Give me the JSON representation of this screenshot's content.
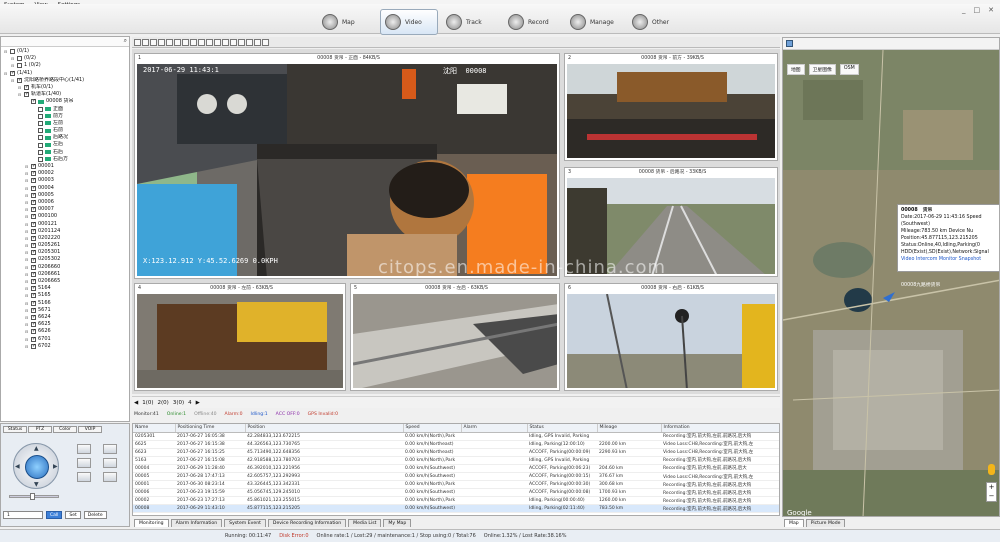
{
  "menu": {
    "items": [
      "System",
      "View",
      "Settings"
    ]
  },
  "nav": {
    "tabs": [
      {
        "id": "map",
        "label": "Map",
        "icon": "map-icon"
      },
      {
        "id": "video",
        "label": "Video",
        "icon": "video-icon",
        "active": true
      },
      {
        "id": "track",
        "label": "Track",
        "icon": "track-icon"
      },
      {
        "id": "record",
        "label": "Record",
        "icon": "record-icon"
      },
      {
        "id": "manage",
        "label": "Manage",
        "icon": "manage-icon"
      },
      {
        "id": "other",
        "label": "Other",
        "icon": "other-icon"
      }
    ]
  },
  "window_controls": [
    "_",
    "□",
    "✕"
  ],
  "tree": {
    "rows": [
      {
        "i": 0,
        "t": "(0/1)",
        "cb": false
      },
      {
        "i": 1,
        "t": "(0/2)",
        "cb": false
      },
      {
        "i": 1,
        "t": "1  (0/2)",
        "cb": false
      },
      {
        "i": 0,
        "t": "(1/41)",
        "cb": true
      },
      {
        "i": 1,
        "t": "沈阳路桥养路段中心(1/41)",
        "cb": true
      },
      {
        "i": 2,
        "t": "机车(0/1)",
        "cb": true
      },
      {
        "i": 2,
        "t": "轨道车(1/40)",
        "cb": true
      },
      {
        "i": 3,
        "t": "00008  货吊",
        "cb": true,
        "v": true
      },
      {
        "i": 4,
        "t": "正面",
        "cb": false,
        "v": true
      },
      {
        "i": 4,
        "t": "前方",
        "cb": false,
        "v": true
      },
      {
        "i": 4,
        "t": "左前",
        "cb": false,
        "v": true
      },
      {
        "i": 4,
        "t": "右前",
        "cb": false,
        "v": true
      },
      {
        "i": 4,
        "t": "后路况",
        "cb": false,
        "v": true
      },
      {
        "i": 4,
        "t": "左后",
        "cb": false,
        "v": true
      },
      {
        "i": 4,
        "t": "右后",
        "cb": false,
        "v": true
      },
      {
        "i": 4,
        "t": "右后方",
        "cb": false,
        "v": true
      },
      {
        "i": 3,
        "t": "00001",
        "cb": true
      },
      {
        "i": 3,
        "t": "00002",
        "cb": true
      },
      {
        "i": 3,
        "t": "00003",
        "cb": true
      },
      {
        "i": 3,
        "t": "00004",
        "cb": true
      },
      {
        "i": 3,
        "t": "00005",
        "cb": true
      },
      {
        "i": 3,
        "t": "00006",
        "cb": true
      },
      {
        "i": 3,
        "t": "00007",
        "cb": true
      },
      {
        "i": 3,
        "t": "000100",
        "cb": true
      },
      {
        "i": 3,
        "t": "000121",
        "cb": true
      },
      {
        "i": 3,
        "t": "0201124",
        "cb": true
      },
      {
        "i": 3,
        "t": "0202220",
        "cb": true
      },
      {
        "i": 3,
        "t": "0205261",
        "cb": true
      },
      {
        "i": 3,
        "t": "0205301",
        "cb": true
      },
      {
        "i": 3,
        "t": "0205302",
        "cb": true
      },
      {
        "i": 3,
        "t": "0206660",
        "cb": true
      },
      {
        "i": 3,
        "t": "0206661",
        "cb": true
      },
      {
        "i": 3,
        "t": "0206665",
        "cb": true
      },
      {
        "i": 3,
        "t": "5164",
        "cb": true
      },
      {
        "i": 3,
        "t": "5165",
        "cb": true
      },
      {
        "i": 3,
        "t": "5166",
        "cb": true
      },
      {
        "i": 3,
        "t": "5671",
        "cb": true
      },
      {
        "i": 3,
        "t": "6624",
        "cb": true
      },
      {
        "i": 3,
        "t": "6625",
        "cb": true
      },
      {
        "i": 3,
        "t": "6626",
        "cb": true
      },
      {
        "i": 3,
        "t": "6701",
        "cb": true
      },
      {
        "i": 3,
        "t": "6702",
        "cb": true
      }
    ]
  },
  "ptz": {
    "tabs": [
      "Status",
      "PTZ",
      "Color",
      "VOIP"
    ],
    "preset": "1",
    "buttons": [
      "Call",
      "Set",
      "Delete"
    ]
  },
  "videos": [
    {
      "num": "1",
      "veh": "00008",
      "ch": "货吊 - 正面",
      "speed": "84KB/S",
      "time": "2017-06-29 11:43:1",
      "coord": "X:123.12.912 Y:45.52.6269 0.0KPH",
      "plate": "沈阳",
      "code": "00008"
    },
    {
      "num": "2",
      "veh": "00008",
      "ch": "货吊 - 前方",
      "speed": "39KB/S"
    },
    {
      "num": "3",
      "veh": "00008",
      "ch": "货吊 - 后路况",
      "speed": "33KB/S"
    },
    {
      "num": "4",
      "veh": "00008",
      "ch": "货吊 - 左前",
      "speed": "63KB/S"
    },
    {
      "num": "5",
      "veh": "00008",
      "ch": "货吊 - 左后",
      "speed": "63KB/S"
    },
    {
      "num": "6",
      "veh": "00008",
      "ch": "货吊 - 右后",
      "speed": "61KB/S"
    }
  ],
  "watermark": "citops.en.made-in-china.com",
  "pager": {
    "items": [
      "1(0)",
      "2(0)",
      "3(0)",
      "4"
    ]
  },
  "stats": [
    "Monitor:41",
    "Online:1",
    "Offline:40",
    "Alarm:0",
    "Idling:1",
    "ACC OFF:0",
    "GPS Invalid:0"
  ],
  "gps": {
    "headers": [
      "Name",
      "Positioning Time",
      "Position",
      "Speed",
      "Alarm",
      "Status",
      "Mileage",
      "Information"
    ],
    "rows": [
      [
        "0205301",
        "2017-06-27 16:05:38",
        "42.284833,123.672215",
        "0.00 km/h(North),Park",
        "",
        "Idling, GPS Invalid, Parking",
        "",
        "Recording:室内,前大钩,左前,前路况,后大钩"
      ],
      [
        "6625",
        "2017-06-27 16:15:38",
        "44.326563,123.730765",
        "0.00 km/h(Northeast)",
        "",
        "Idling, Parking(12:00:10)",
        "2200.00 km",
        "Video Loss:CH8,Recording:室内,前大钩,左"
      ],
      [
        "6623",
        "2017-06-27 16:15:25",
        "45.713490,122.648356",
        "0.00 km/h(Northeast)",
        "",
        "ACCOFF, Parking(00:00:09)",
        "2290.93 km",
        "Video Loss:CH8,Recording:室内,前大钩,左"
      ],
      [
        "5163",
        "2017-06-27 16:15:08",
        "42.918588,123.780703",
        "0.00 km/h(North),Park",
        "",
        "Idling, GPS Invalid, Parking",
        "",
        "Recording:室内,前大钩,左前,前路况,后大钩"
      ],
      [
        "00004",
        "2017-06-29 11:28:40",
        "46.392010,123.221956",
        "0.00 km/h(Southwest)",
        "",
        "ACCOFF, Parking(00:06:23)",
        "204.60 km",
        "Recording:室内,前大钩,左前,前路况,后大"
      ],
      [
        "00005",
        "2017-06-28 17:47:13",
        "42.605757,123.292993",
        "0.00 km/h(Southwest)",
        "",
        "ACCOFF, Parking(00:00:15)",
        "376.67 km",
        "Video Loss:CH8,Recording:室内,前大钩,左"
      ],
      [
        "00001",
        "2017-06-30 08:23:14",
        "43.326445,123.342331",
        "0.00 km/h(North),Park",
        "",
        "ACCOFF, Parking(00:00:30)",
        "300.68 km",
        "Recording:室内,前大钩,左前,前路况,后大钩"
      ],
      [
        "00006",
        "2017-06-23 19:15:59",
        "45.056745,129.245010",
        "0.00 km/h(Southwest)",
        "",
        "ACCOFF, Parking(00:00:08)",
        "1700.93 km",
        "Recording:室内,前大钩,左前,前路况,后大钩"
      ],
      [
        "00002",
        "2017-06-23 17:27:13",
        "45.861021,123.255015",
        "0.00 km/h(North),Park",
        "",
        "Idling, Parking(00:00:40)",
        "1260.00 km",
        "Recording:室内,前大钩,左前,前路况,后大钩"
      ],
      [
        "00008",
        "2017-06-29 11:43:10",
        "45.877115,123.215205",
        "0.00 km/h(Southwest)",
        "",
        "Idling, Parking(02:11:40)",
        "783.50 km",
        "Recording:室内,前大钩,左前,前路况,后大钩"
      ]
    ]
  },
  "bottom_tabs": [
    "Monitoring",
    "Alarm Information",
    "System Event",
    "Device Recording Information",
    "Media List",
    "My Map"
  ],
  "map": {
    "types": [
      "地图",
      "卫星图像",
      "OSM"
    ],
    "info": {
      "title": "00008",
      "title_cn": "货吊",
      "lines": [
        "Date:2017-06-29 11:43:16  Speed",
        "(Southwest)",
        "Mileage:783.50 km  Device Nu",
        "Position:45.877115,123.215205",
        "Status:Online,40,Idling,Parking(0",
        "HDD(Exist),SD(Exist),Network:Signal"
      ],
      "links": "Video Intercom Monitor Snapshot"
    },
    "marker_label": "00008九路桥货吊",
    "google": "Google",
    "tabs": [
      "Map",
      "Picture Mode"
    ]
  },
  "status": {
    "running": "Running: 00:11:47",
    "disk": "Disk Error:0",
    "online": "Online rate:1 / Lost:29 / maintenance:1 / Stop using:0 / Total:76",
    "rate": "Online:1.32% / Lost Rate:38.16%"
  }
}
